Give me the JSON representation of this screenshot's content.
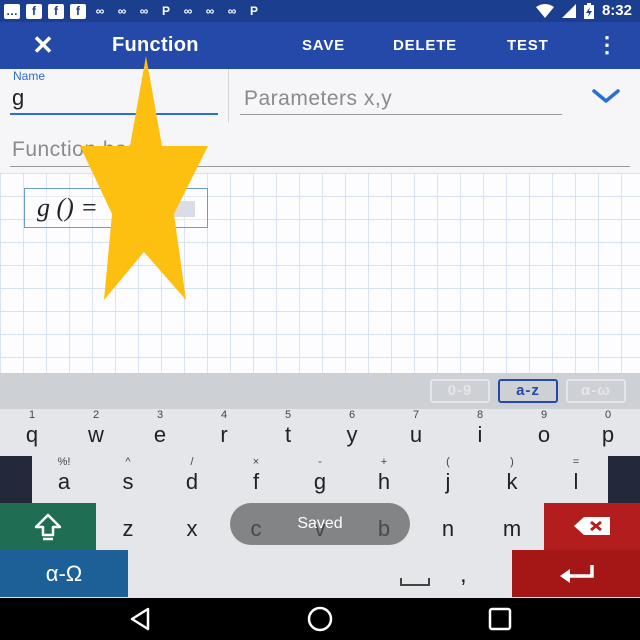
{
  "status_bar": {
    "left_icons": [
      "…",
      "f",
      "f",
      "f",
      "∞",
      "∞",
      "∞",
      "P",
      "∞",
      "∞",
      "∞",
      "P"
    ],
    "time": "8:32"
  },
  "app_bar": {
    "close_icon": "close-icon",
    "title": "Function",
    "save_label": "SAVE",
    "delete_label": "DELETE",
    "test_label": "TEST",
    "more_icon": "more-vert-icon"
  },
  "form": {
    "name_label": "Name",
    "name_value": "g",
    "params_placeholder": "Parameters x,y",
    "function_placeholder": "Function body"
  },
  "expression": {
    "text": "g () ="
  },
  "keyboard": {
    "modes": [
      "0-9",
      "a-z",
      "α-ω"
    ],
    "active_mode": "a-z",
    "row1": [
      {
        "sup": "1",
        "key": "q"
      },
      {
        "sup": "2",
        "key": "w"
      },
      {
        "sup": "3",
        "key": "e"
      },
      {
        "sup": "4",
        "key": "r"
      },
      {
        "sup": "5",
        "key": "t"
      },
      {
        "sup": "6",
        "key": "y"
      },
      {
        "sup": "7",
        "key": "u"
      },
      {
        "sup": "8",
        "key": "i"
      },
      {
        "sup": "9",
        "key": "o"
      },
      {
        "sup": "0",
        "key": "p"
      }
    ],
    "row2": [
      {
        "sup": "%!",
        "key": "a"
      },
      {
        "sup": "^",
        "key": "s"
      },
      {
        "sup": "/",
        "key": "d"
      },
      {
        "sup": "×",
        "key": "f"
      },
      {
        "sup": "-",
        "key": "g"
      },
      {
        "sup": "+",
        "key": "h"
      },
      {
        "sup": "(",
        "key": "j"
      },
      {
        "sup": ")",
        "key": "k"
      },
      {
        "sup": "=",
        "key": "l"
      }
    ],
    "row3": [
      "z",
      "x",
      "c",
      "v",
      "b",
      "n",
      "m"
    ],
    "alpha_label": "α-Ω",
    "comma_label": ","
  },
  "toast": {
    "text": "Saved"
  },
  "colors": {
    "status_bar": "#1b3e8f",
    "app_bar": "#2549a8",
    "accent": "#2b6fd6",
    "star": "#fdc010",
    "shift_key": "#1f6d52",
    "backspace_key": "#b31d1d",
    "alpha_key": "#1d5f97"
  }
}
